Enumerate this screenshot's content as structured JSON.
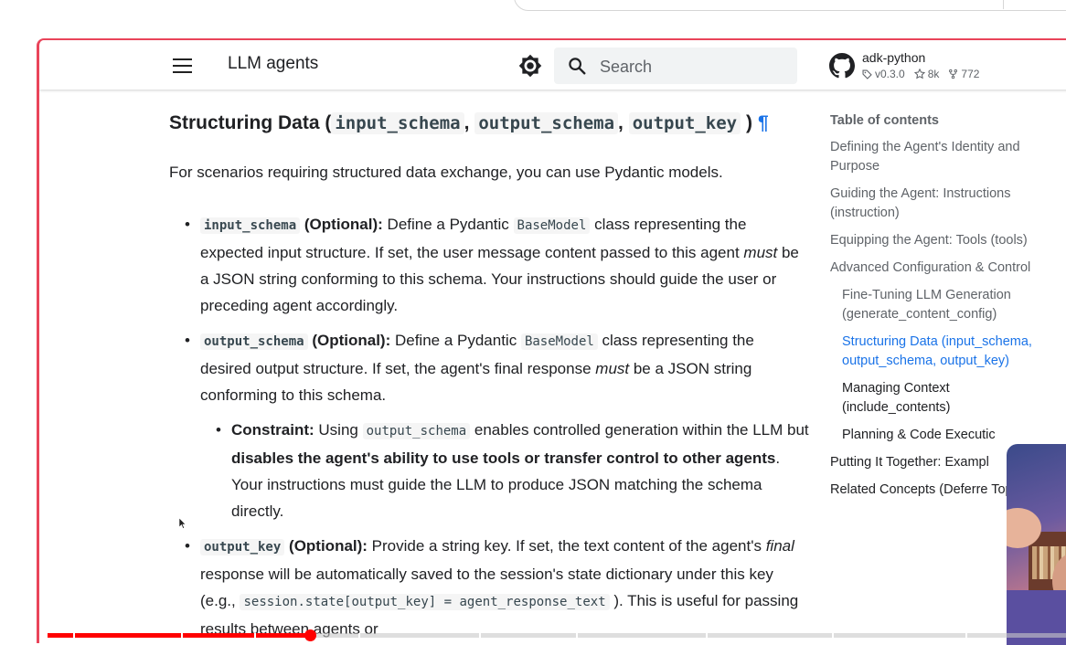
{
  "header": {
    "site_title": "LLM agents",
    "search_placeholder": "Search",
    "repo_name": "adk-python",
    "repo_version": "v0.3.0",
    "repo_stars": "8k",
    "repo_forks": "772"
  },
  "content": {
    "heading_prefix": "Structuring Data (",
    "heading_code_1": "input_schema",
    "heading_sep_1": ",",
    "heading_code_2": "output_schema",
    "heading_sep_2": ",",
    "heading_code_3": "output_key",
    "heading_suffix": ")",
    "permalink": "¶",
    "intro": "For scenarios requiring structured data exchange, you can use Pydantic models.",
    "bullet1": {
      "code": "input_schema",
      "label": "(Optional):",
      "t1": " Define a Pydantic ",
      "code2": "BaseModel",
      "t2": " class representing the expected input structure. If set, the user message content passed to this agent ",
      "em": "must",
      "t3": " be a JSON string conforming to this schema. Your instructions should guide the user or preceding agent accordingly."
    },
    "bullet2": {
      "code": "output_schema",
      "label": "(Optional):",
      "t1": " Define a Pydantic ",
      "code2": "BaseModel",
      "t2": " class representing the desired output structure. If set, the agent's final response ",
      "em": "must",
      "t3": " be a JSON string conforming to this schema.",
      "sub": {
        "label": "Constraint:",
        "t1": " Using ",
        "code": "output_schema",
        "t2": " enables controlled generation within the LLM but ",
        "bold": "disables the agent's ability to use tools or transfer control to other agents",
        "t3": ". Your instructions must guide the LLM to produce JSON matching the schema directly."
      }
    },
    "bullet3": {
      "code": "output_key",
      "label": "(Optional):",
      "t1": " Provide a string key. If set, the text content of the agent's ",
      "em": "final",
      "t2": " response will be automatically saved to the session's state dictionary under this key (e.g., ",
      "code2": "session.state[output_key] = agent_response_text",
      "t3": " ). This is useful for passing results between agents or"
    }
  },
  "toc": {
    "title": "Table of contents",
    "items": [
      "Defining the Agent's Identity and Purpose",
      "Guiding the Agent: Instructions (instruction)",
      "Equipping the Agent: Tools (tools)",
      "Advanced Configuration & Control",
      "Fine-Tuning LLM Generation (generate_content_config)",
      "Structuring Data (input_schema, output_schema, output_key)",
      "Managing Context (include_contents)",
      "Planning & Code Executic",
      "Putting It Together: Exampl",
      "Related Concepts (Deferre Topics)"
    ]
  },
  "video": {
    "progress": 0.258
  },
  "colors": {
    "accent_link": "#1a73e8",
    "frame_accent": "#e9445a",
    "progress": "#ff0000"
  }
}
